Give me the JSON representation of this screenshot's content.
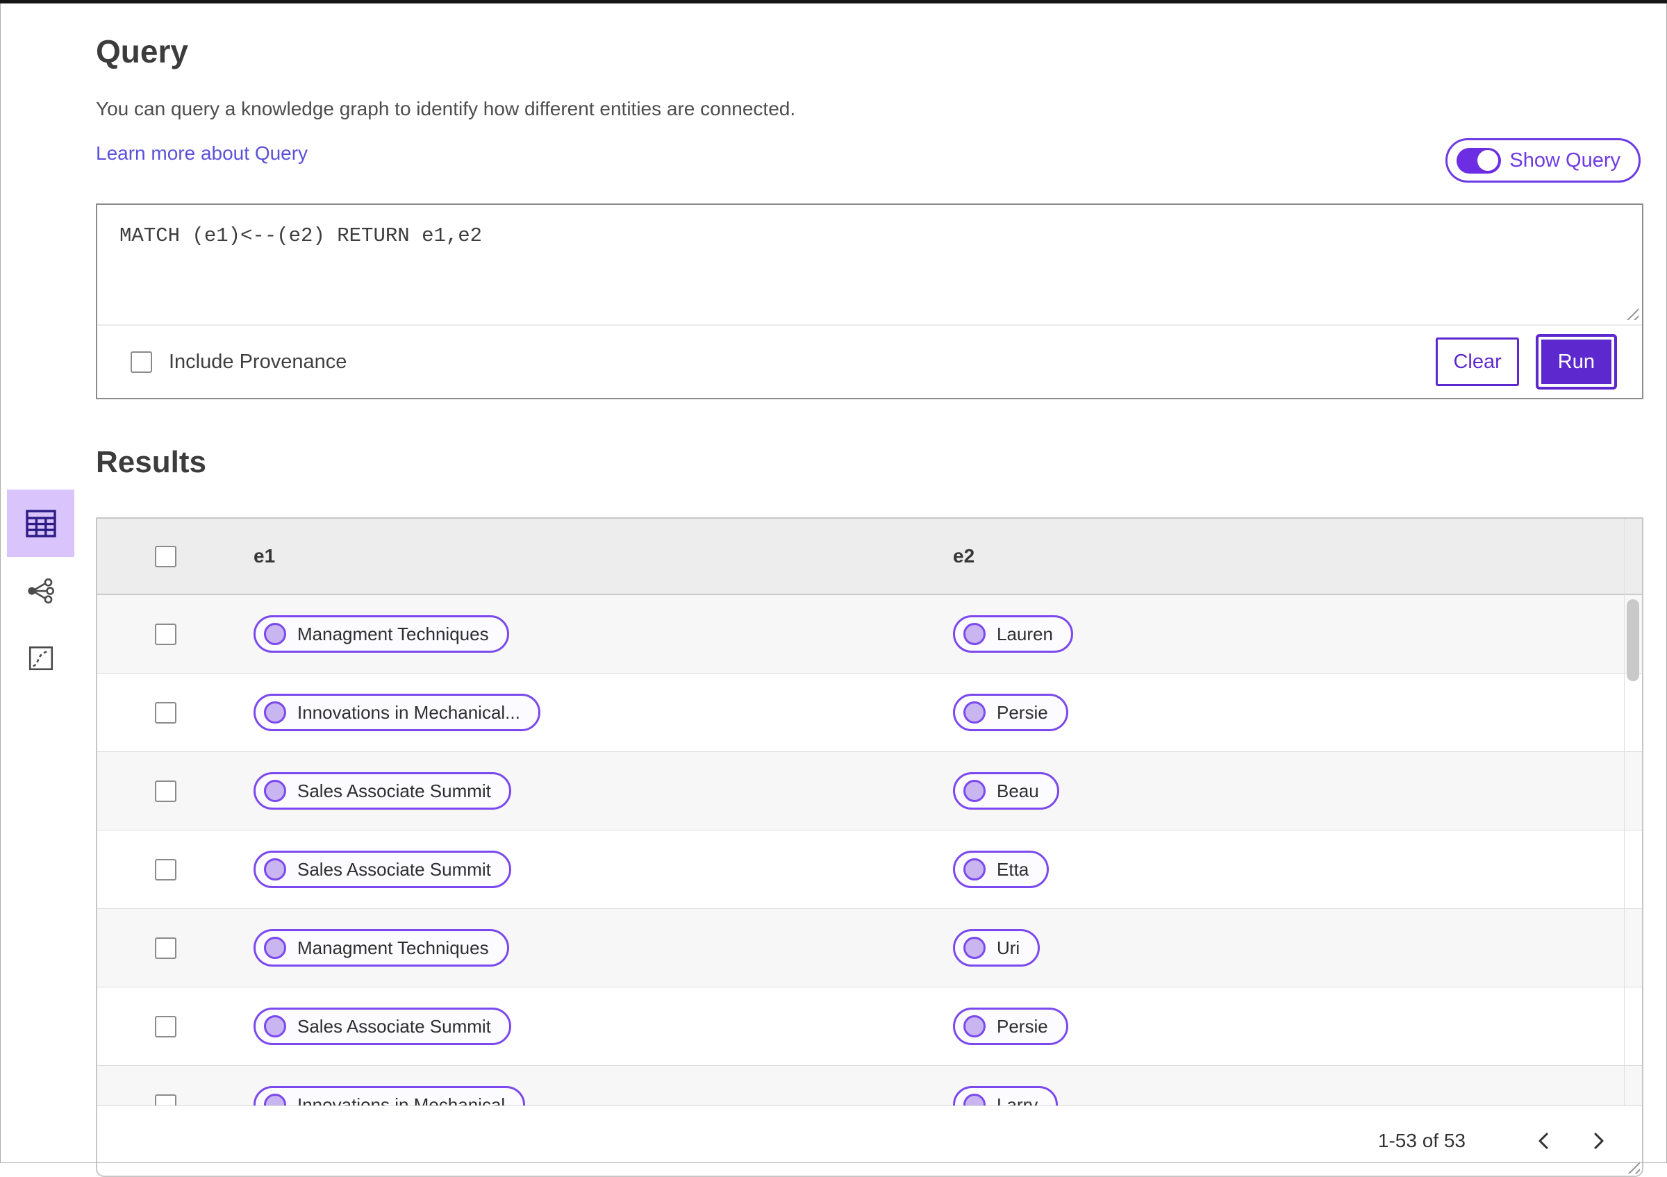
{
  "colors": {
    "primary": "#5d29cf",
    "entity_border": "#7b49ee",
    "entity_dot_fill": "#c9b6f1",
    "selected_view_bg": "#d9c5fb",
    "link": "#5b51d8",
    "table_header_bg": "#ededed",
    "row_alt_bg": "#f7f7f7"
  },
  "query": {
    "title": "Query",
    "description": "You can query a knowledge graph to identify how different entities are connected.",
    "learn_more_link": "Learn more about Query",
    "show_query_toggle": {
      "label": "Show Query",
      "state": "on"
    },
    "editor_text": "MATCH (e1)<--(e2) RETURN e1,e2",
    "include_provenance": {
      "label": "Include Provenance",
      "checked": false
    },
    "buttons": {
      "clear": "Clear",
      "run": "Run"
    }
  },
  "results": {
    "title": "Results",
    "views": [
      {
        "icon": "table-view-icon",
        "selected": true
      },
      {
        "icon": "graph-view-icon",
        "selected": false
      },
      {
        "icon": "chart-view-icon",
        "selected": false
      }
    ],
    "table": {
      "columns": [
        "e1",
        "e2"
      ],
      "rows": [
        {
          "e1": "Managment Techniques",
          "e2": "Lauren"
        },
        {
          "e1": "Innovations in Mechanical...",
          "e2": "Persie"
        },
        {
          "e1": "Sales Associate Summit",
          "e2": "Beau"
        },
        {
          "e1": "Sales Associate Summit",
          "e2": "Etta"
        },
        {
          "e1": "Managment Techniques",
          "e2": "Uri"
        },
        {
          "e1": "Sales Associate Summit",
          "e2": "Persie"
        },
        {
          "e1": "Innovations in Mechanical",
          "e2": "Larry"
        }
      ]
    },
    "pagination": {
      "range_text": "1-53 of 53"
    }
  }
}
